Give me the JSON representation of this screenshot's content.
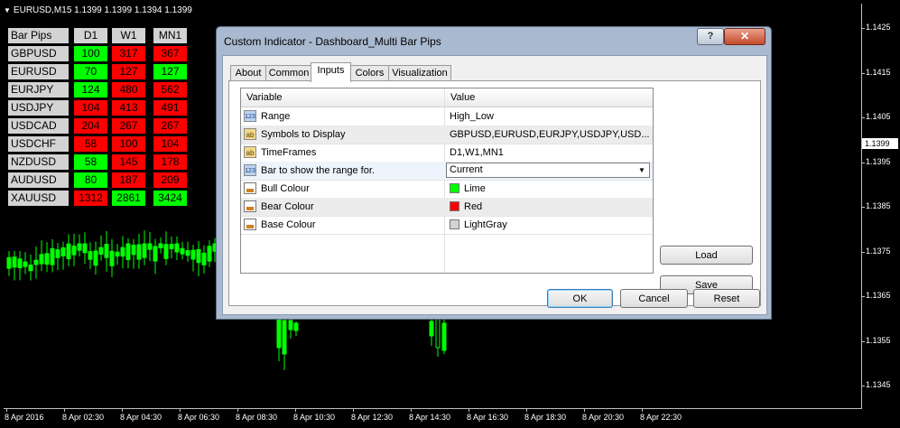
{
  "chart": {
    "header": "EURUSD,M15  1.1399 1.1399 1.1394 1.1399",
    "current_price": "1.1399",
    "price_labels": [
      "1.1425",
      "1.1415",
      "1.1405",
      "1.1395",
      "1.1385",
      "1.1375",
      "1.1365",
      "1.1355",
      "1.1345"
    ],
    "time_labels": [
      "8 Apr 2016",
      "8 Apr 02:30",
      "8 Apr 04:30",
      "8 Apr 06:30",
      "8 Apr 08:30",
      "8 Apr 10:30",
      "8 Apr 12:30",
      "8 Apr 14:30",
      "8 Apr 16:30",
      "8 Apr 18:30",
      "8 Apr 20:30",
      "8 Apr 22:30"
    ],
    "colors": {
      "background": "#000000",
      "bull": "#00ff00",
      "text": "#ffffff"
    }
  },
  "dashboard": {
    "headers": [
      "Bar Pips",
      "D1",
      "W1",
      "MN1"
    ],
    "rows": [
      {
        "symbol": "GBPUSD",
        "values": [
          "100",
          "317",
          "367"
        ],
        "colors": [
          "lime",
          "red",
          "red"
        ]
      },
      {
        "symbol": "EURUSD",
        "values": [
          "70",
          "127",
          "127"
        ],
        "colors": [
          "lime",
          "red",
          "lime"
        ]
      },
      {
        "symbol": "EURJPY",
        "values": [
          "124",
          "480",
          "562"
        ],
        "colors": [
          "lime",
          "red",
          "red"
        ]
      },
      {
        "symbol": "USDJPY",
        "values": [
          "104",
          "413",
          "491"
        ],
        "colors": [
          "red",
          "red",
          "red"
        ]
      },
      {
        "symbol": "USDCAD",
        "values": [
          "204",
          "267",
          "267"
        ],
        "colors": [
          "red",
          "red",
          "red"
        ]
      },
      {
        "symbol": "USDCHF",
        "values": [
          "58",
          "100",
          "104"
        ],
        "colors": [
          "red",
          "red",
          "red"
        ]
      },
      {
        "symbol": "NZDUSD",
        "values": [
          "58",
          "145",
          "178"
        ],
        "colors": [
          "lime",
          "red",
          "red"
        ]
      },
      {
        "symbol": "AUDUSD",
        "values": [
          "80",
          "187",
          "209"
        ],
        "colors": [
          "lime",
          "red",
          "red"
        ]
      },
      {
        "symbol": "XAUUSD",
        "values": [
          "1312",
          "2861",
          "3424"
        ],
        "colors": [
          "red",
          "lime",
          "lime"
        ]
      }
    ]
  },
  "dialog": {
    "title": "Custom Indicator - Dashboard_Multi Bar Pips",
    "help_label": "?",
    "close_label": "✕",
    "tabs": [
      "About",
      "Common",
      "Inputs",
      "Colors",
      "Visualization"
    ],
    "active_tab": "Inputs",
    "grid": {
      "col_variable": "Variable",
      "col_value": "Value",
      "rows": [
        {
          "icon": "123",
          "name": "Range",
          "value": "High_Low"
        },
        {
          "icon": "ab",
          "name": "Symbols to Display",
          "value": "GBPUSD,EURUSD,EURJPY,USDJPY,USD..."
        },
        {
          "icon": "ab",
          "name": "TimeFrames",
          "value": "D1,W1,MN1"
        },
        {
          "icon": "123",
          "name": "Bar to show the range for.",
          "value": "Current"
        },
        {
          "icon": "color",
          "name": "Bull Colour",
          "value": "Lime",
          "swatch": "#00ff00"
        },
        {
          "icon": "color",
          "name": "Bear Colour",
          "value": "Red",
          "swatch": "#ff0000"
        },
        {
          "icon": "color",
          "name": "Base Colour",
          "value": "LightGray",
          "swatch": "#d3d3d3"
        }
      ]
    },
    "buttons": {
      "load": "Load",
      "save": "Save",
      "ok": "OK",
      "cancel": "Cancel",
      "reset": "Reset"
    }
  }
}
